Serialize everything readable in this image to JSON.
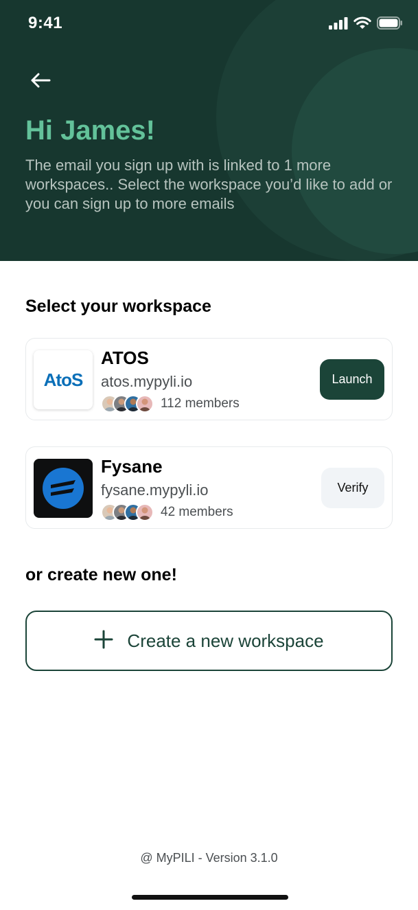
{
  "status_bar": {
    "time": "9:41",
    "icons": [
      "cellular-signal-icon",
      "wifi-icon",
      "battery-icon"
    ]
  },
  "header": {
    "back_icon": "arrow-left-icon",
    "greeting": "Hi James!",
    "description": "The email you sign up with is linked to 1 more workspaces.. Select the workspace you’d like to add or you can sign up to more emails"
  },
  "select_section": {
    "title": "Select your workspace",
    "workspaces": [
      {
        "name": "ATOS",
        "logo_text": "AtoS",
        "domain": "atos.mypyli.io",
        "members": "112 members",
        "action_label": "Launch"
      },
      {
        "name": "Fysane",
        "domain": "fysane.mypyli.io",
        "members": "42 members",
        "action_label": "Verify"
      }
    ]
  },
  "create_section": {
    "title": "or create new one!",
    "button_label": "Create a new workspace",
    "button_icon": "plus-icon"
  },
  "footer": {
    "version": "@ MyPILI - Version 3.1.0"
  },
  "colors": {
    "header_bg": "#17372f",
    "accent_green": "#63c29a",
    "primary_dark_green": "#1b4438",
    "atos_blue": "#0a6fb8",
    "fysane_blue": "#1976d2"
  }
}
